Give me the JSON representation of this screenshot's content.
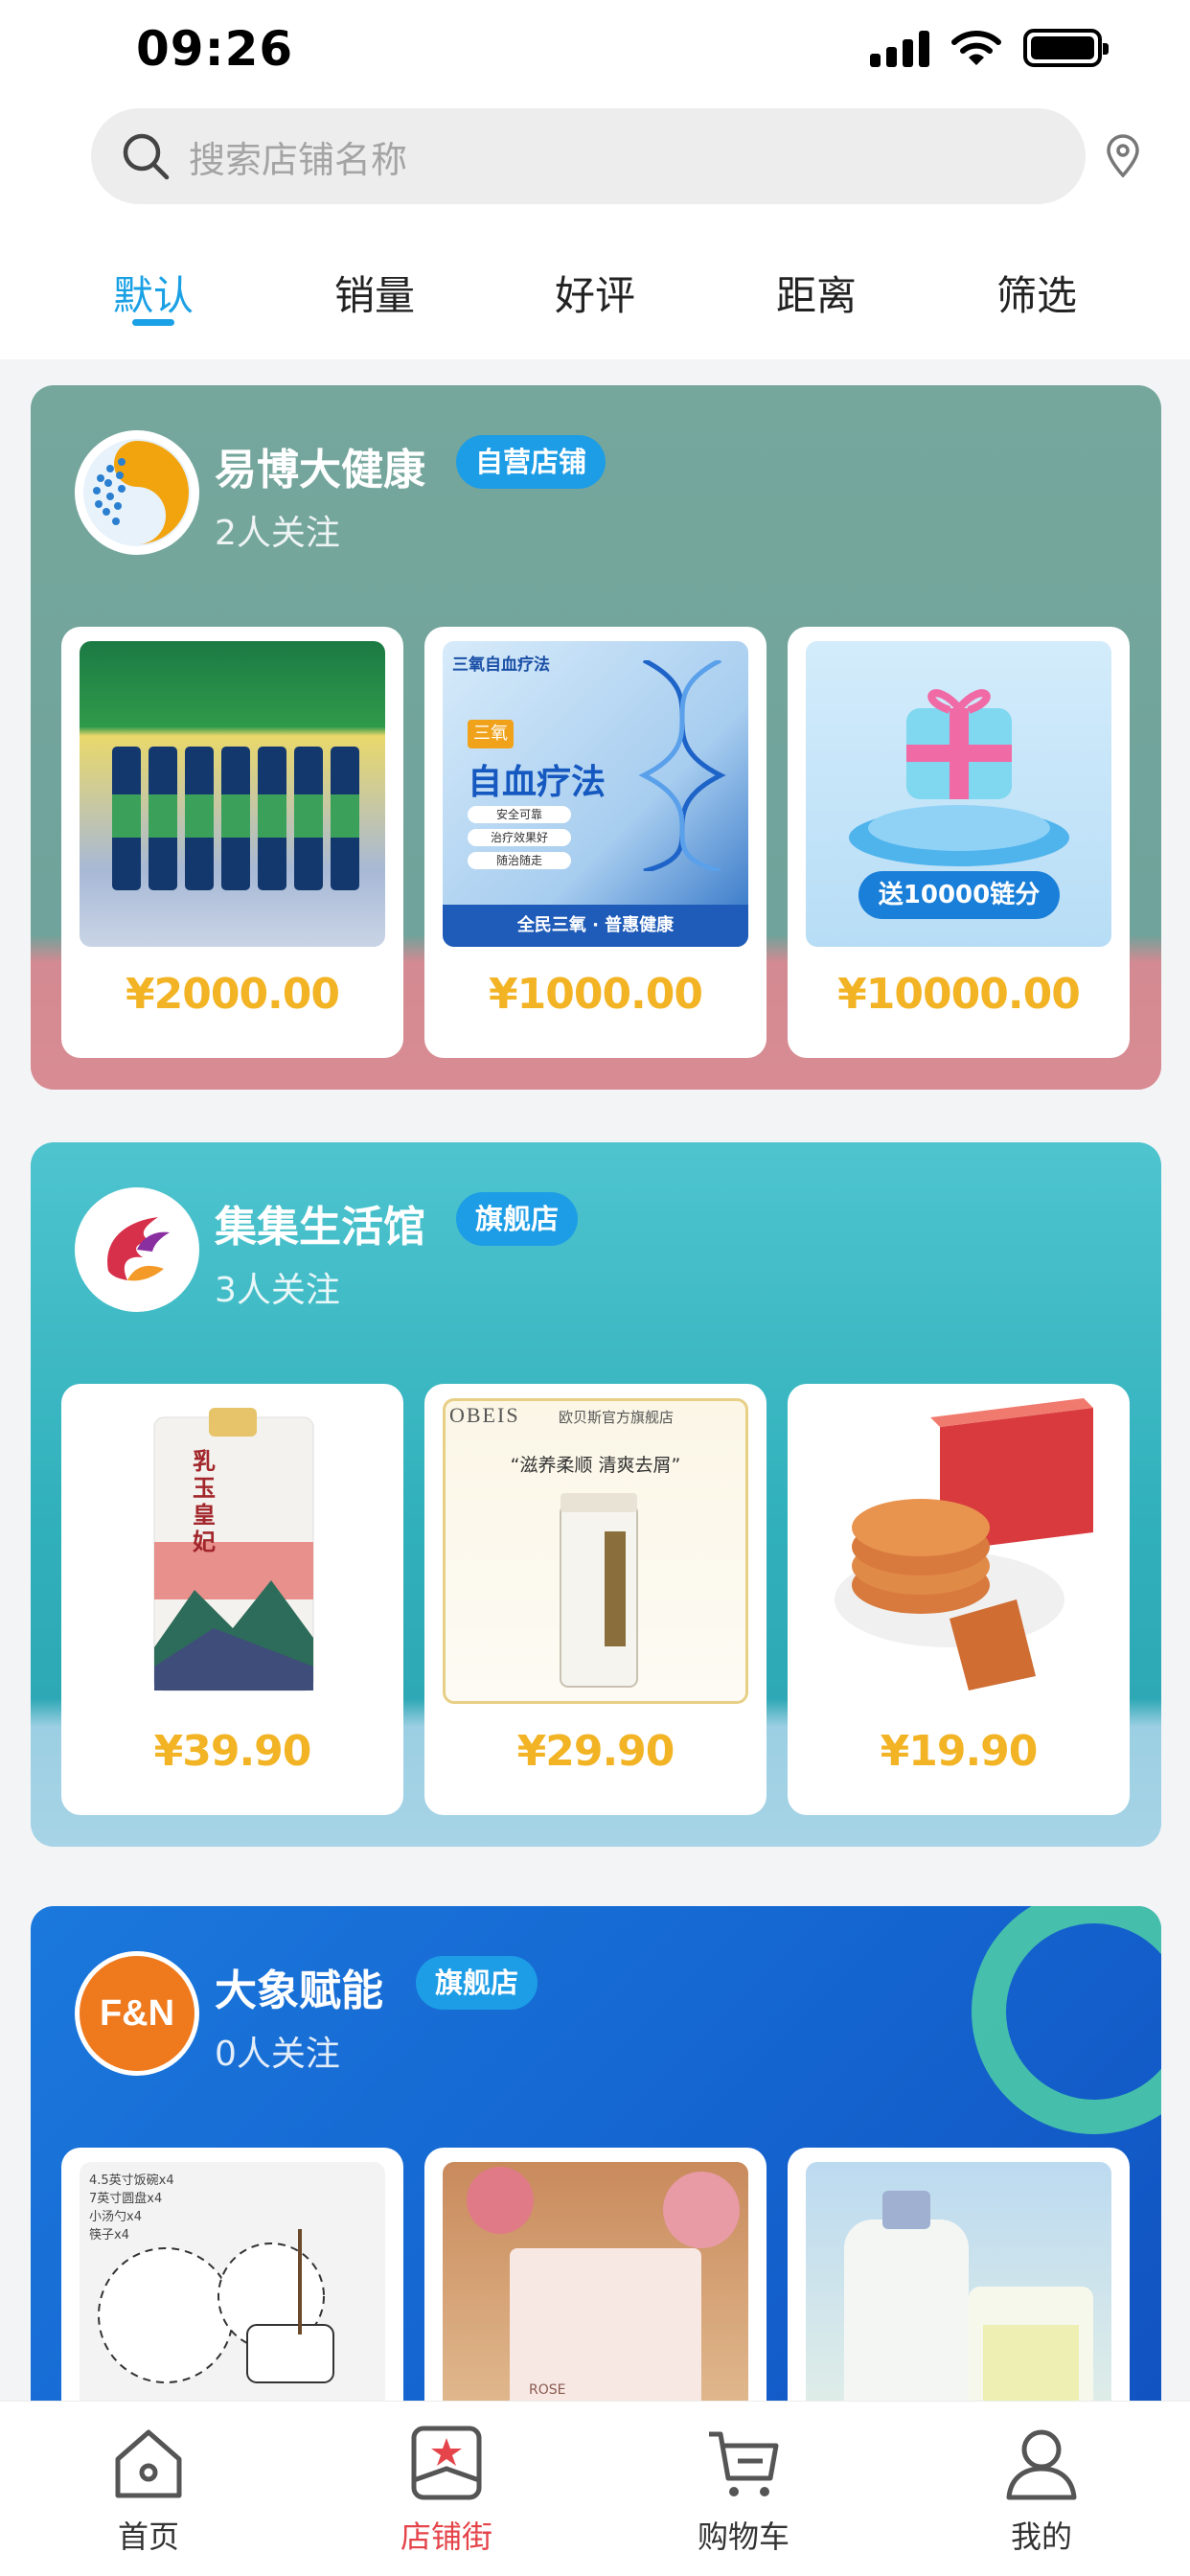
{
  "status_bar": {
    "time": "09:26"
  },
  "search": {
    "placeholder": "搜索店铺名称"
  },
  "sort_tabs": [
    "默认",
    "销量",
    "好评",
    "距离",
    "筛选"
  ],
  "active_sort_tab": "默认",
  "stores": [
    {
      "name": "易博大健康",
      "tag": "自营店铺",
      "followers": "2人关注",
      "products": [
        {
          "price": "¥2000.00"
        },
        {
          "price": "¥1000.00",
          "image_text": {
            "header": "三氧自血疗法",
            "badge": "三氧",
            "title": "自血疗法",
            "bullets": [
              "安全可靠",
              "治疗效果好",
              "随治随走"
            ],
            "footer": "全民三氧 · 普惠健康"
          }
        },
        {
          "price": "¥10000.00",
          "image_text": {
            "banner": "送10000链分"
          }
        }
      ]
    },
    {
      "name": "集集生活馆",
      "tag": "旗舰店",
      "followers": "3人关注",
      "products": [
        {
          "price": "¥39.90",
          "image_text": {
            "title": "乳玉皇妃"
          }
        },
        {
          "price": "¥29.90",
          "image_text": {
            "brand": "OBEIS",
            "store": "欧贝斯官方旗舰店",
            "slogan": "“滋养柔顺 清爽去屑”"
          }
        },
        {
          "price": "¥19.90"
        }
      ]
    },
    {
      "name": "大象赋能",
      "logo_text": "F&N",
      "tag": "旗舰店",
      "followers": "0人关注",
      "products": [
        {
          "price": "",
          "image_text": {
            "lines": [
              "4.5英寸饭碗x4",
              "7英寸圆盘x4",
              "小汤勺x4",
              "筷子x4"
            ]
          }
        },
        {
          "price": "",
          "image_text": {
            "label": "ROSE"
          }
        },
        {
          "price": ""
        }
      ]
    }
  ],
  "bottom_nav": [
    {
      "label": "首页",
      "icon": "home-icon",
      "active": false
    },
    {
      "label": "店铺街",
      "icon": "store-icon",
      "active": true
    },
    {
      "label": "购物车",
      "icon": "cart-icon",
      "active": false
    },
    {
      "label": "我的",
      "icon": "user-icon",
      "active": false
    }
  ],
  "colors": {
    "accent_blue": "#1aa0e4",
    "price_gold": "#f2b324",
    "nav_active": "#e4444a",
    "store1_bg": "#74a79e",
    "store2_bg": "#2fb3bf",
    "store3_bg": "#1568d2"
  }
}
